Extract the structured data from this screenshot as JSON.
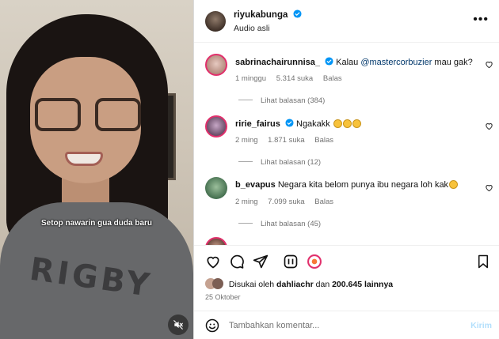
{
  "video": {
    "caption": "Setop nawarin gua duda baru",
    "shirt_print": "RIGBY",
    "mute_icon": "speaker-muted-icon"
  },
  "header": {
    "username": "riyukabunga",
    "audio": "Audio asli",
    "more": "•••"
  },
  "comments": [
    {
      "username": "sabrinachairunnisa_",
      "text_before": "Kalau ",
      "mention": "@mastercorbuzier",
      "text_after": " mau gak?",
      "time": "1 minggu",
      "likes": "5.314 suka",
      "reply": "Balas",
      "view_replies": "Lihat balasan (384)"
    },
    {
      "username": "ririe_fairus",
      "text": "Ngakakk",
      "time": "2 ming",
      "likes": "1.871 suka",
      "reply": "Balas",
      "view_replies": "Lihat balasan (12)"
    },
    {
      "username": "b_evapus",
      "text": "Negara kita belom punya ibu negara loh kak",
      "time": "2 ming",
      "likes": "7.099 suka",
      "reply": "Balas",
      "view_replies": "Lihat balasan (45)"
    }
  ],
  "likes": {
    "prefix": "Disukai oleh ",
    "user": "dahliachr",
    "middle": " dan ",
    "count": "200.645 lainnya"
  },
  "date": "25 Oktober",
  "composer": {
    "placeholder": "Tambahkan komentar...",
    "post": "Kirim"
  },
  "colors": {
    "story_ring": "#e1306c",
    "verified": "#0095f6",
    "post_disabled": "#b2dffc"
  }
}
